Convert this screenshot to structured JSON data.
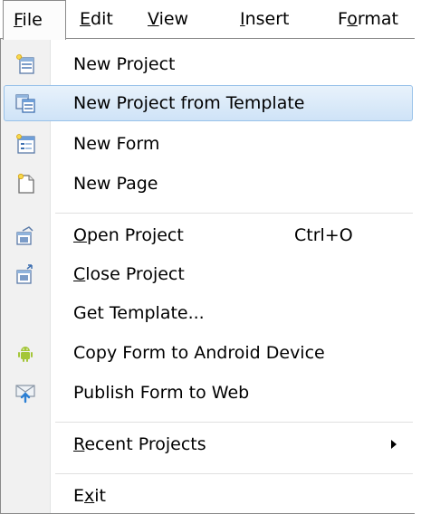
{
  "menubar": {
    "file": "File",
    "edit": "Edit",
    "view": "View",
    "insert": "Insert",
    "format": "Format"
  },
  "menu": {
    "new_project": "New Project",
    "new_project_template": "New Project from Template",
    "new_form": "New Form",
    "new_page": "New Page",
    "open_project": "Open Project",
    "open_project_shortcut": "Ctrl+O",
    "close_project": "Close Project",
    "get_template": "Get Template...",
    "copy_form_android": "Copy Form to Android Device",
    "publish_form_web": "Publish Form to Web",
    "recent_projects": "Recent Projects",
    "exit": "Exit"
  },
  "colors": {
    "highlight_border": "#99c2ea",
    "highlight_fill": "#cfe3f7",
    "gutter": "#f1f1f1",
    "android_green": "#a4c639"
  },
  "icons": {
    "new_project": "new-project-icon",
    "new_project_template": "template-copy-icon",
    "new_form": "form-icon",
    "new_page": "new-page-icon",
    "open_project": "open-project-icon",
    "close_project": "close-project-icon",
    "copy_form_android": "android-icon",
    "publish_form_web": "publish-web-icon"
  }
}
